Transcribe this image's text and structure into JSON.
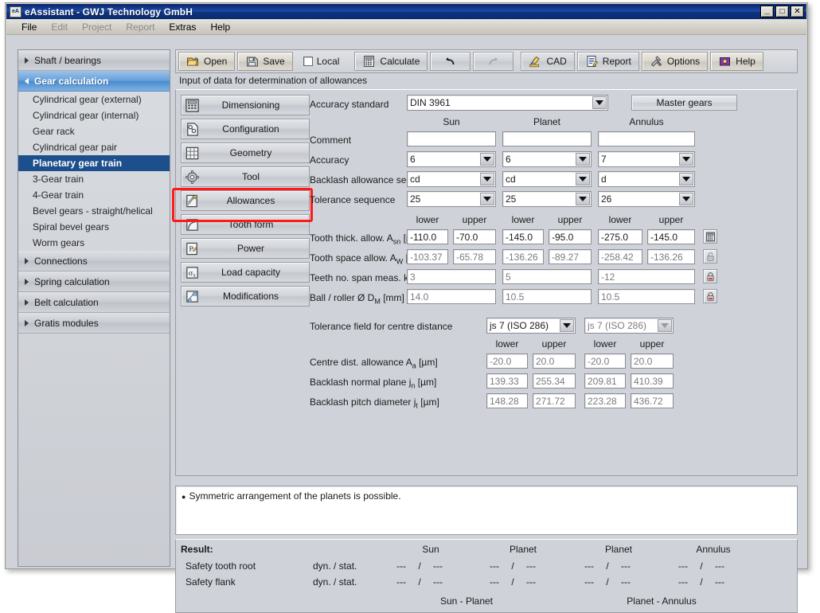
{
  "window": {
    "title": "eAssistant - GWJ Technology GmbH",
    "icon_label": "eA",
    "minimize": "_",
    "maximize": "□",
    "close": "✕"
  },
  "menubar": {
    "items": [
      {
        "label": "File",
        "disabled": false
      },
      {
        "label": "Edit",
        "disabled": true
      },
      {
        "label": "Project",
        "disabled": true
      },
      {
        "label": "Report",
        "disabled": true
      },
      {
        "label": "Extras",
        "disabled": false
      },
      {
        "label": "Help",
        "disabled": false
      }
    ]
  },
  "sidebar": {
    "groups": [
      {
        "label": "Shaft / bearings",
        "expanded": false,
        "children": []
      },
      {
        "label": "Gear calculation",
        "expanded": true,
        "children": [
          {
            "label": "Cylindrical gear (external)",
            "selected": false
          },
          {
            "label": "Cylindrical gear (internal)",
            "selected": false
          },
          {
            "label": "Gear rack",
            "selected": false
          },
          {
            "label": "Cylindrical gear pair",
            "selected": false
          },
          {
            "label": "Planetary gear train",
            "selected": true
          },
          {
            "label": "3-Gear train",
            "selected": false
          },
          {
            "label": "4-Gear train",
            "selected": false
          },
          {
            "label": "Bevel gears - straight/helical",
            "selected": false
          },
          {
            "label": "Spiral bevel gears",
            "selected": false
          },
          {
            "label": "Worm gears",
            "selected": false
          }
        ]
      },
      {
        "label": "Connections",
        "expanded": false,
        "children": []
      },
      {
        "label": "Spring calculation",
        "expanded": false,
        "children": []
      },
      {
        "label": "Belt calculation",
        "expanded": false,
        "children": []
      },
      {
        "label": "Gratis modules",
        "expanded": false,
        "children": []
      }
    ]
  },
  "toolbar": {
    "open_label": "Open",
    "save_label": "Save",
    "local_label": "Local",
    "local_checked": false,
    "calculate_label": "Calculate",
    "cad_label": "CAD",
    "report_label": "Report",
    "options_label": "Options",
    "help_label": "Help"
  },
  "subheader": "Input of data for determination of allowances",
  "side_buttons": [
    {
      "label": "Dimensioning",
      "icon": "calculator-icon"
    },
    {
      "label": "Configuration",
      "icon": "config-icon"
    },
    {
      "label": "Geometry",
      "icon": "grid-icon"
    },
    {
      "label": "Tool",
      "icon": "gear-icon"
    },
    {
      "label": "Allowances",
      "icon": "allowances-icon",
      "highlighted": true
    },
    {
      "label": "Tooth form",
      "icon": "toothform-icon"
    },
    {
      "label": "Power",
      "icon": "power-icon"
    },
    {
      "label": "Load capacity",
      "icon": "sigma-icon"
    },
    {
      "label": "Modifications",
      "icon": "modifications-icon"
    }
  ],
  "form": {
    "accuracy_standard_label": "Accuracy standard",
    "accuracy_standard_value": "DIN 3961",
    "master_gears_label": "Master gears",
    "columns": [
      "Sun",
      "Planet",
      "Annulus"
    ],
    "comment_label": "Comment",
    "comment_values": [
      "",
      "",
      ""
    ],
    "accuracy_label": "Accuracy",
    "accuracy_values": [
      "6",
      "6",
      "7"
    ],
    "backlash_seq_label": "Backlash allowance seq.",
    "backlash_seq_values": [
      "cd",
      "cd",
      "d"
    ],
    "tolerance_seq_label": "Tolerance sequence",
    "tolerance_seq_values": [
      "25",
      "25",
      "26"
    ],
    "lower_label": "lower",
    "upper_label": "upper",
    "rows": [
      {
        "label_html": "Tooth thick. allow. A<sub>sn</sub> [µm]",
        "name": "tooth-thickness-allowance",
        "values": [
          "-110.0",
          "-70.0",
          "-145.0",
          "-95.0",
          "-275.0",
          "-145.0"
        ],
        "readonly": false,
        "trailing_icon": "calculator-icon"
      },
      {
        "label_html": "Tooth space allow. A<sub>W</sub> [µm]",
        "name": "tooth-space-allowance",
        "values": [
          "-103.37",
          "-65.78",
          "-136.26",
          "-89.27",
          "-258.42",
          "-136.26"
        ],
        "readonly": true,
        "trailing_icon": "lock-open-icon"
      }
    ],
    "wide_rows": [
      {
        "label_html": "Teeth no. span meas. k [-]",
        "name": "teeth-number-span-measurement",
        "values": [
          "3",
          "5",
          "-12"
        ],
        "trailing_icon": "lock-closed-icon"
      },
      {
        "label_html": "Ball / roller Ø D<sub>M</sub> [mm]",
        "name": "ball-roller-diameter",
        "values": [
          "14.0",
          "10.5",
          "10.5"
        ],
        "trailing_icon": "lock-closed-icon"
      }
    ],
    "tolerance_field_label": "Tolerance field for centre distance",
    "tolerance_field_values": [
      "js 7 (ISO 286)",
      "js 7 (ISO 286)"
    ],
    "centre_rows": [
      {
        "label_html": "Centre dist. allowance A<sub>a</sub> [µm]",
        "name": "centre-distance-allowance",
        "values": [
          "-20.0",
          "20.0",
          "-20.0",
          "20.0"
        ]
      },
      {
        "label_html": "Backlash normal plane j<sub>n</sub> [µm]",
        "name": "backlash-normal-plane",
        "values": [
          "139.33",
          "255.34",
          "209.81",
          "410.39"
        ]
      },
      {
        "label_html": "Backlash pitch diameter j<sub>t</sub> [µm]",
        "name": "backlash-pitch-diameter",
        "values": [
          "148.28",
          "271.72",
          "223.28",
          "436.72"
        ]
      }
    ]
  },
  "message": {
    "bullet": "●",
    "text": "Symmetric arrangement of the planets is possible."
  },
  "result": {
    "title": "Result:",
    "columns": [
      "Sun",
      "Planet",
      "Planet",
      "Annulus"
    ],
    "rows": [
      {
        "label": "Safety tooth root",
        "mode": "dyn. / stat.",
        "values": [
          "---",
          "---",
          "---",
          "---",
          "---",
          "---",
          "---",
          "---"
        ]
      },
      {
        "label": "Safety flank",
        "mode": "dyn. / stat.",
        "values": [
          "---",
          "---",
          "---",
          "---",
          "---",
          "---",
          "---",
          "---"
        ]
      }
    ],
    "separator": "/",
    "footers": [
      "Sun - Planet",
      "Planet - Annulus"
    ]
  },
  "colors": {
    "title_blue": "#0a246a",
    "accent_blue": "#1c4f8b",
    "panel_bg": "#cfd3d9",
    "highlight_red": "#ff1a1a"
  }
}
